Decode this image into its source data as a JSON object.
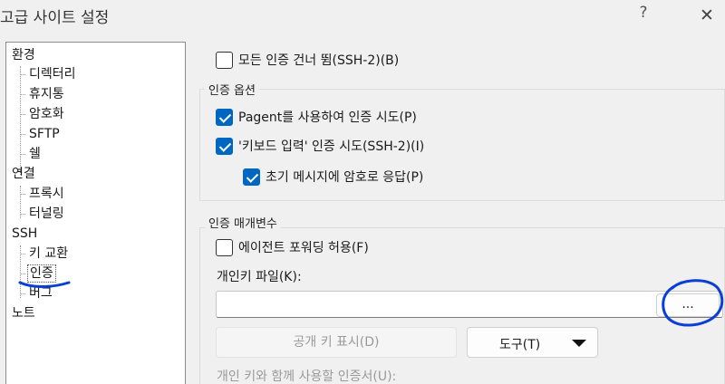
{
  "window": {
    "title": "고급 사이트 설정",
    "help_label": "?",
    "close_label": "✕"
  },
  "tree": {
    "items": [
      {
        "label": "환경"
      },
      {
        "label": "디렉터리"
      },
      {
        "label": "휴지통"
      },
      {
        "label": "암호화"
      },
      {
        "label": "SFTP"
      },
      {
        "label": "쉘"
      },
      {
        "label": "연결"
      },
      {
        "label": "프록시"
      },
      {
        "label": "터널링"
      },
      {
        "label": "SSH"
      },
      {
        "label": "키 교환"
      },
      {
        "label": "인증",
        "selected": true
      },
      {
        "label": "버그"
      },
      {
        "label": "노트"
      }
    ]
  },
  "auth": {
    "skip_all_label": "모든 인증 건너 뜀(SSH-2)(B)",
    "skip_all_checked": false,
    "options_title": "인증 옵션",
    "pageant_label": "Pagent를 사용하여 인증 시도(P)",
    "pageant_checked": true,
    "keyboard_label": "'키보드 입력' 인증 시도(SSH-2)(I)",
    "keyboard_checked": true,
    "respond_label": "초기 메시지에 암호로 응답(P)",
    "respond_checked": true,
    "params_title": "인증 매개변수",
    "agent_fwd_label": "에이전트 포워딩 허용(F)",
    "agent_fwd_checked": false,
    "keyfile_label": "개인키 파일(K):",
    "keyfile_value": "",
    "browse_label": "...",
    "show_pubkey_label": "공개 키 표시(D)",
    "tools_label": "도구(T)",
    "cert_label": "개인 키와 함께 사용할 인증서(U):"
  },
  "colors": {
    "accent": "#0067c0",
    "annotation": "#0a3fd6"
  }
}
